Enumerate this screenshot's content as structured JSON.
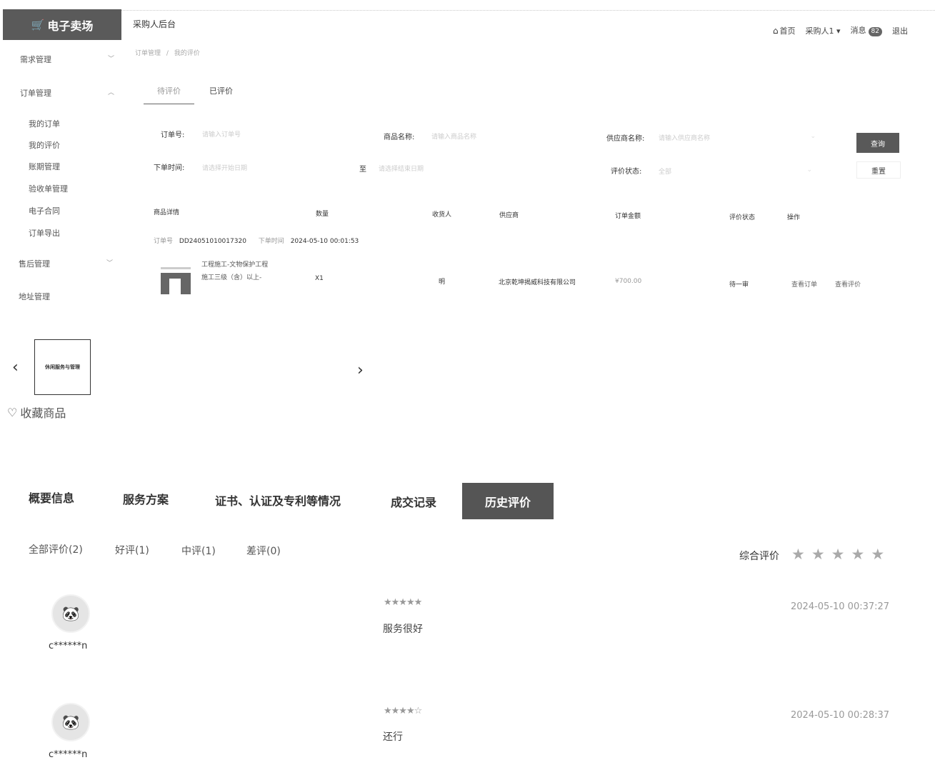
{
  "header": {
    "logo_text": "电子卖场",
    "app_title": "采购人后台",
    "home_label": "首页",
    "user_label": "采购人1",
    "messages_label": "消息",
    "messages_count": "82",
    "logout_label": "退出"
  },
  "sidebar": {
    "groups": [
      {
        "label": "需求管理",
        "chevron": "chevron-down-icon"
      },
      {
        "label": "订单管理",
        "chevron": "chevron-up-icon"
      },
      {
        "label": "售后管理",
        "chevron": "chevron-down-icon"
      },
      {
        "label": "地址管理"
      }
    ],
    "order_items": [
      "我的订单",
      "我的评价",
      "账期管理",
      "验收单管理",
      "电子合同",
      "订单导出"
    ]
  },
  "breadcrumb": {
    "root": "订单管理",
    "sep": "/",
    "current": "我的评价"
  },
  "order_tabs": [
    {
      "label": "待评价",
      "active": true
    },
    {
      "label": "已评价",
      "active": false
    }
  ],
  "filters": {
    "order_no_label": "订单号:",
    "order_no_placeholder": "请输入订单号",
    "product_label": "商品名称:",
    "product_placeholder": "请输入商品名称",
    "supplier_label": "供应商名称:",
    "supplier_placeholder": "请输入供应商名称",
    "time_label": "下单时间:",
    "time_start_placeholder": "请选择开始日期",
    "to_label": "至",
    "time_end_placeholder": "请选择结束日期",
    "status_label": "评价状态:",
    "status_placeholder": "全部",
    "query_label": "查询",
    "reset_label": "重置"
  },
  "table": {
    "headers": [
      "商品详情",
      "数量",
      "收货人",
      "供应商",
      "订单金额",
      "评价状态",
      "操作"
    ],
    "order_no_label": "订单号",
    "order_no": "DD24051010017320",
    "order_time_label": "下单时间",
    "order_time": "2024-05-10 00:01:53",
    "row": {
      "product_line1": "工程施工-文物保护工程",
      "product_line2": "施工三级（含）以上-",
      "qty": "X1",
      "receiver": "明",
      "supplier": "北京乾坤揭威科技有限公司",
      "amount": "¥700.00",
      "status": "待一审",
      "view_order": "查看订单",
      "view_review": "查看评价"
    }
  },
  "product": {
    "carousel_thumb_text": "休闲服务与管理",
    "favorite_label": "收藏商品"
  },
  "detail_tabs": [
    {
      "label": "概要信息",
      "active": false
    },
    {
      "label": "服务方案",
      "active": false
    },
    {
      "label": "证书、认证及专利等情况",
      "active": false
    },
    {
      "label": "成交记录",
      "active": false
    },
    {
      "label": "历史评价",
      "active": true
    }
  ],
  "review_filters": [
    "全部评价(2)",
    "好评(1)",
    "中评(1)",
    "差评(0)"
  ],
  "overall_rating": {
    "label": "综合评价",
    "stars": 5
  },
  "reviews": [
    {
      "user": "c******n",
      "rating": 5,
      "stars_text": "★★★★★",
      "text": "服务很好",
      "date": "2024-05-10 00:37:27"
    },
    {
      "user": "c******n",
      "rating": 4.5,
      "stars_text": "★★★★☆",
      "text": "还行",
      "date": "2024-05-10 00:28:37"
    }
  ]
}
